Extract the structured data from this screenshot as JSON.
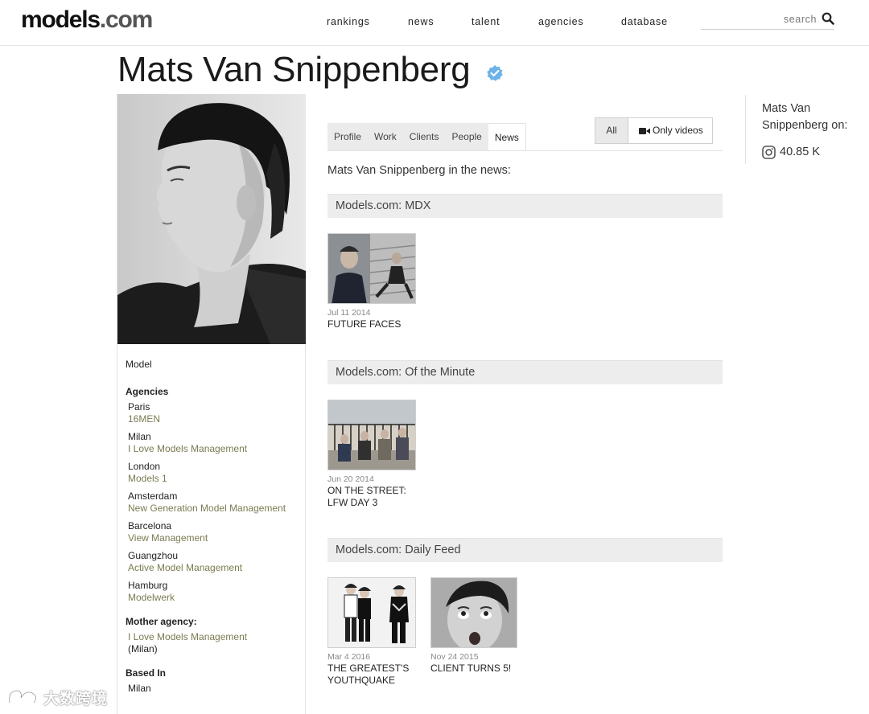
{
  "header": {
    "logo_main": "models",
    "logo_tld": ".com",
    "nav": [
      "rankings",
      "news",
      "talent",
      "agencies",
      "database"
    ],
    "search_placeholder": "search"
  },
  "profile": {
    "name": "Mats Van Snippenberg",
    "role": "Model",
    "agencies_heading": "Agencies",
    "agencies": [
      {
        "city": "Paris",
        "agency": "16MEN"
      },
      {
        "city": "Milan",
        "agency": "I Love Models Management"
      },
      {
        "city": "London",
        "agency": "Models 1"
      },
      {
        "city": "Amsterdam",
        "agency": "New Generation Model Management"
      },
      {
        "city": "Barcelona",
        "agency": "View Management"
      },
      {
        "city": "Guangzhou",
        "agency": "Active Model Management"
      },
      {
        "city": "Hamburg",
        "agency": "Modelwerk"
      }
    ],
    "mother_heading": "Mother agency:",
    "mother_agency": "I Love Models Management",
    "mother_city": "(Milan)",
    "based_heading": "Based In",
    "based_city": "Milan"
  },
  "tabs": {
    "items": [
      "Profile",
      "Work",
      "Clients",
      "People",
      "News"
    ],
    "active": "News",
    "filter_all": "All",
    "filter_videos": "Only videos"
  },
  "news": {
    "intro": "Mats Van Snippenberg in the news:",
    "sections": [
      {
        "title": "Models.com: MDX",
        "items": [
          {
            "date": "Jul 11 2014",
            "headline": "FUTURE FACES"
          }
        ]
      },
      {
        "title": "Models.com: Of the Minute",
        "items": [
          {
            "date": "Jun 20 2014",
            "headline_line1": "ON THE STREET:",
            "headline_line2": "LFW DAY 3"
          }
        ]
      },
      {
        "title": "Models.com: Daily Feed",
        "items": [
          {
            "date": "Mar 4 2016",
            "headline_line1": "THE GREATEST'S",
            "headline_line2": "YOUTHQUAKE"
          },
          {
            "date": "Nov 24 2015",
            "headline": "CLIENT TURNS 5!"
          }
        ]
      }
    ]
  },
  "social": {
    "title": "Mats Van Snippenberg on:",
    "instagram_followers": "40.85 K",
    "icon": "instagram-icon"
  },
  "watermark": {
    "text": "大数跨境"
  },
  "colors": {
    "agency_link": "#7b7b52",
    "verified": "#5aa0d8"
  }
}
